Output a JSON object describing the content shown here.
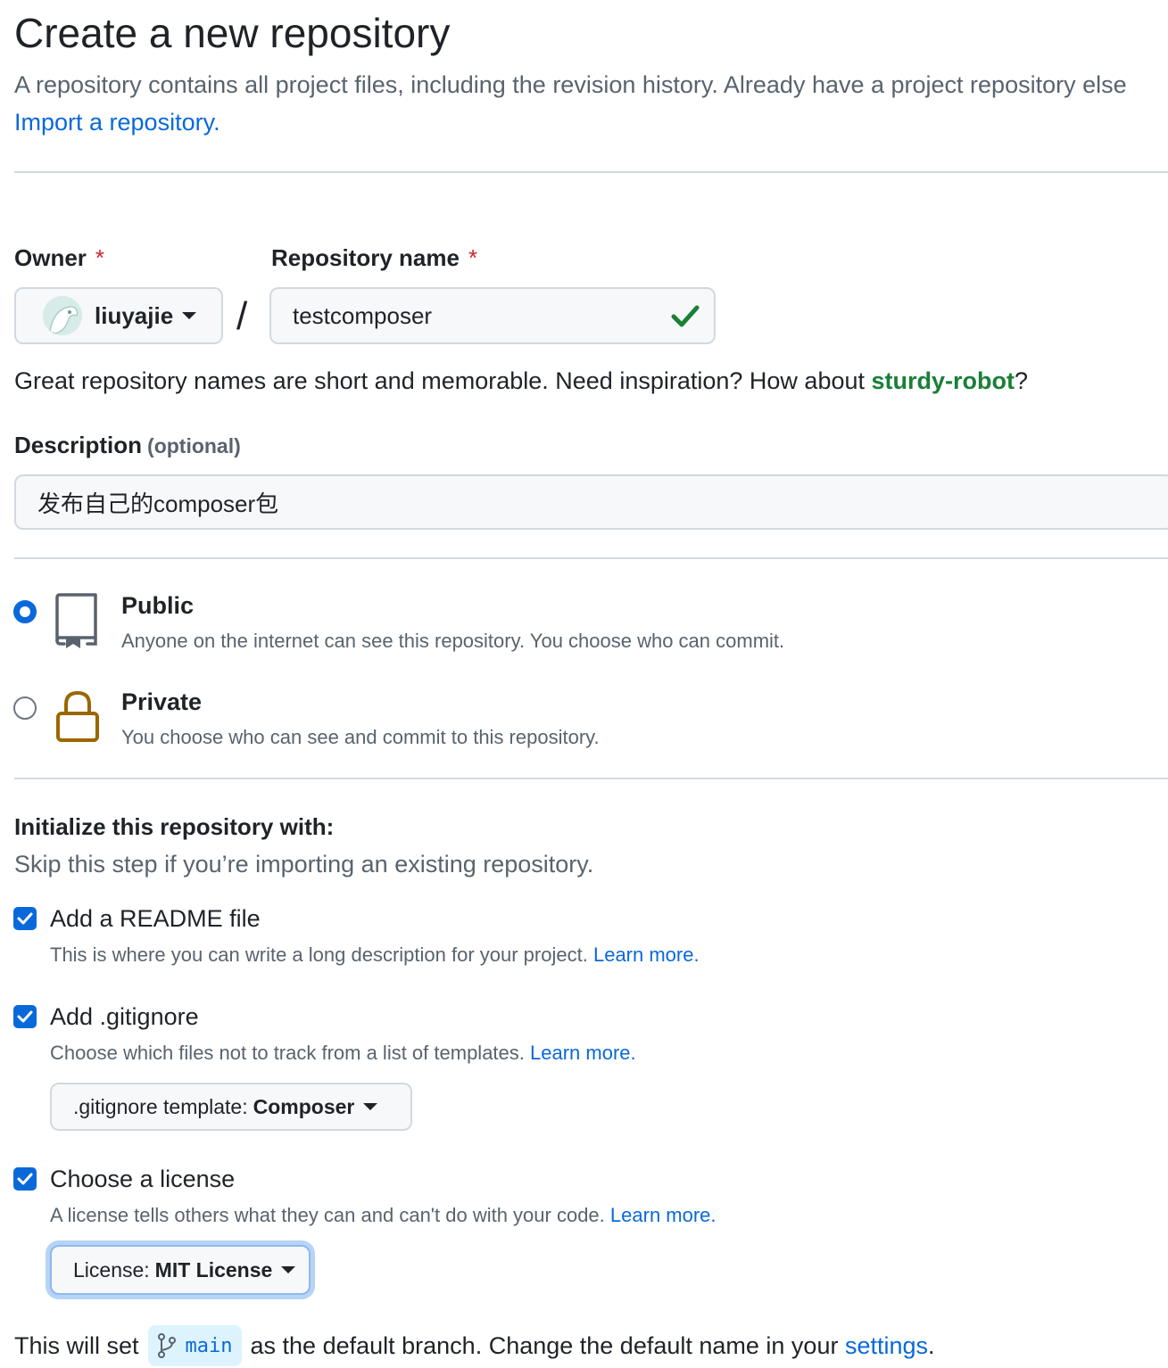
{
  "header": {
    "title": "Create a new repository",
    "subtitle": "A repository contains all project files, including the revision history. Already have a project repository else",
    "import_link": "Import a repository."
  },
  "owner": {
    "label": "Owner",
    "required_mark": "*",
    "value": "liuyajie"
  },
  "separator": "/",
  "repo_name": {
    "label": "Repository name",
    "required_mark": "*",
    "value": "testcomposer",
    "valid": true
  },
  "name_hint": {
    "prefix": "Great repository names are short and memorable. Need inspiration? How about ",
    "suggestion": "sturdy-robot",
    "suffix": "?"
  },
  "description": {
    "label": "Description",
    "optional": "(optional)",
    "value": "发布自己的composer包"
  },
  "visibility": {
    "selected": "public",
    "options": [
      {
        "id": "public",
        "title": "Public",
        "desc": "Anyone on the internet can see this repository. You choose who can commit.",
        "icon": "repo-icon"
      },
      {
        "id": "private",
        "title": "Private",
        "desc": "You choose who can see and commit to this repository.",
        "icon": "lock-icon"
      }
    ]
  },
  "init": {
    "heading": "Initialize this repository with:",
    "subheading": "Skip this step if you’re importing an existing repository.",
    "readme": {
      "title": "Add a README file",
      "desc": "This is where you can write a long description for your project.",
      "learn": "Learn more.",
      "checked": true
    },
    "gitignore": {
      "title": "Add .gitignore",
      "desc": "Choose which files not to track from a list of templates.",
      "learn": "Learn more.",
      "checked": true,
      "select_prefix": ".gitignore template:",
      "select_value": "Composer"
    },
    "license": {
      "title": "Choose a license",
      "desc": "A license tells others what they can and can't do with your code.",
      "learn": "Learn more.",
      "checked": true,
      "select_prefix": "License:",
      "select_value": "MIT License"
    }
  },
  "branch": {
    "prefix": "This will set",
    "name": "main",
    "middle": "as the default branch. Change the default name in your",
    "link": "settings",
    "suffix": "."
  },
  "colors": {
    "accent": "#0969da",
    "success": "#1a7f37",
    "danger": "#d1242f",
    "muted": "#59636e",
    "lock": "#9a6700"
  }
}
